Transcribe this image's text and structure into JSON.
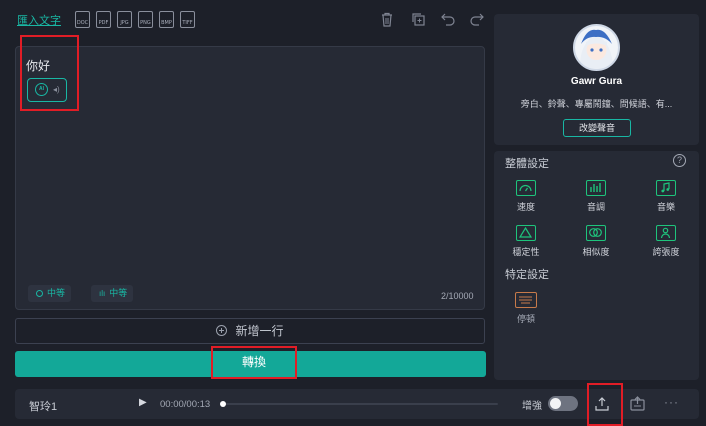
{
  "toolbar": {
    "import_text": "匯入文字",
    "file_types": [
      "DOC",
      "PDF",
      "JPG",
      "PNG",
      "BMP",
      "TIFF"
    ]
  },
  "editor": {
    "text": "你好",
    "ai_badge": "AI",
    "speed_pill": "中等",
    "pitch_pill": "中等",
    "char_count": "2/10000"
  },
  "actions": {
    "add_row": "新增一行",
    "convert": "轉換"
  },
  "voice": {
    "name": "Gawr Gura",
    "description": "旁白、鈴聲、專屬鬧鐘、問候語、有...",
    "change_button": "改變聲音"
  },
  "settings": {
    "overall_title": "整體設定",
    "items": [
      {
        "label": "速度",
        "icon": "speedometer-icon"
      },
      {
        "label": "音調",
        "icon": "bar-chart-icon"
      },
      {
        "label": "音樂",
        "icon": "music-note-icon"
      },
      {
        "label": "穩定性",
        "icon": "triangle-icon"
      },
      {
        "label": "相似度",
        "icon": "overlap-circles-icon"
      },
      {
        "label": "誇張度",
        "icon": "person-icon"
      }
    ],
    "specific_title": "特定設定",
    "pause_label": "停頓"
  },
  "player": {
    "track_name": "智玲1",
    "time": "00:00/00:13",
    "enhance_label": "增強",
    "progress": 0
  },
  "colors": {
    "accent": "#13a898",
    "highlight": "#e11d26",
    "background": "#1d2029",
    "panel": "#262a35"
  }
}
